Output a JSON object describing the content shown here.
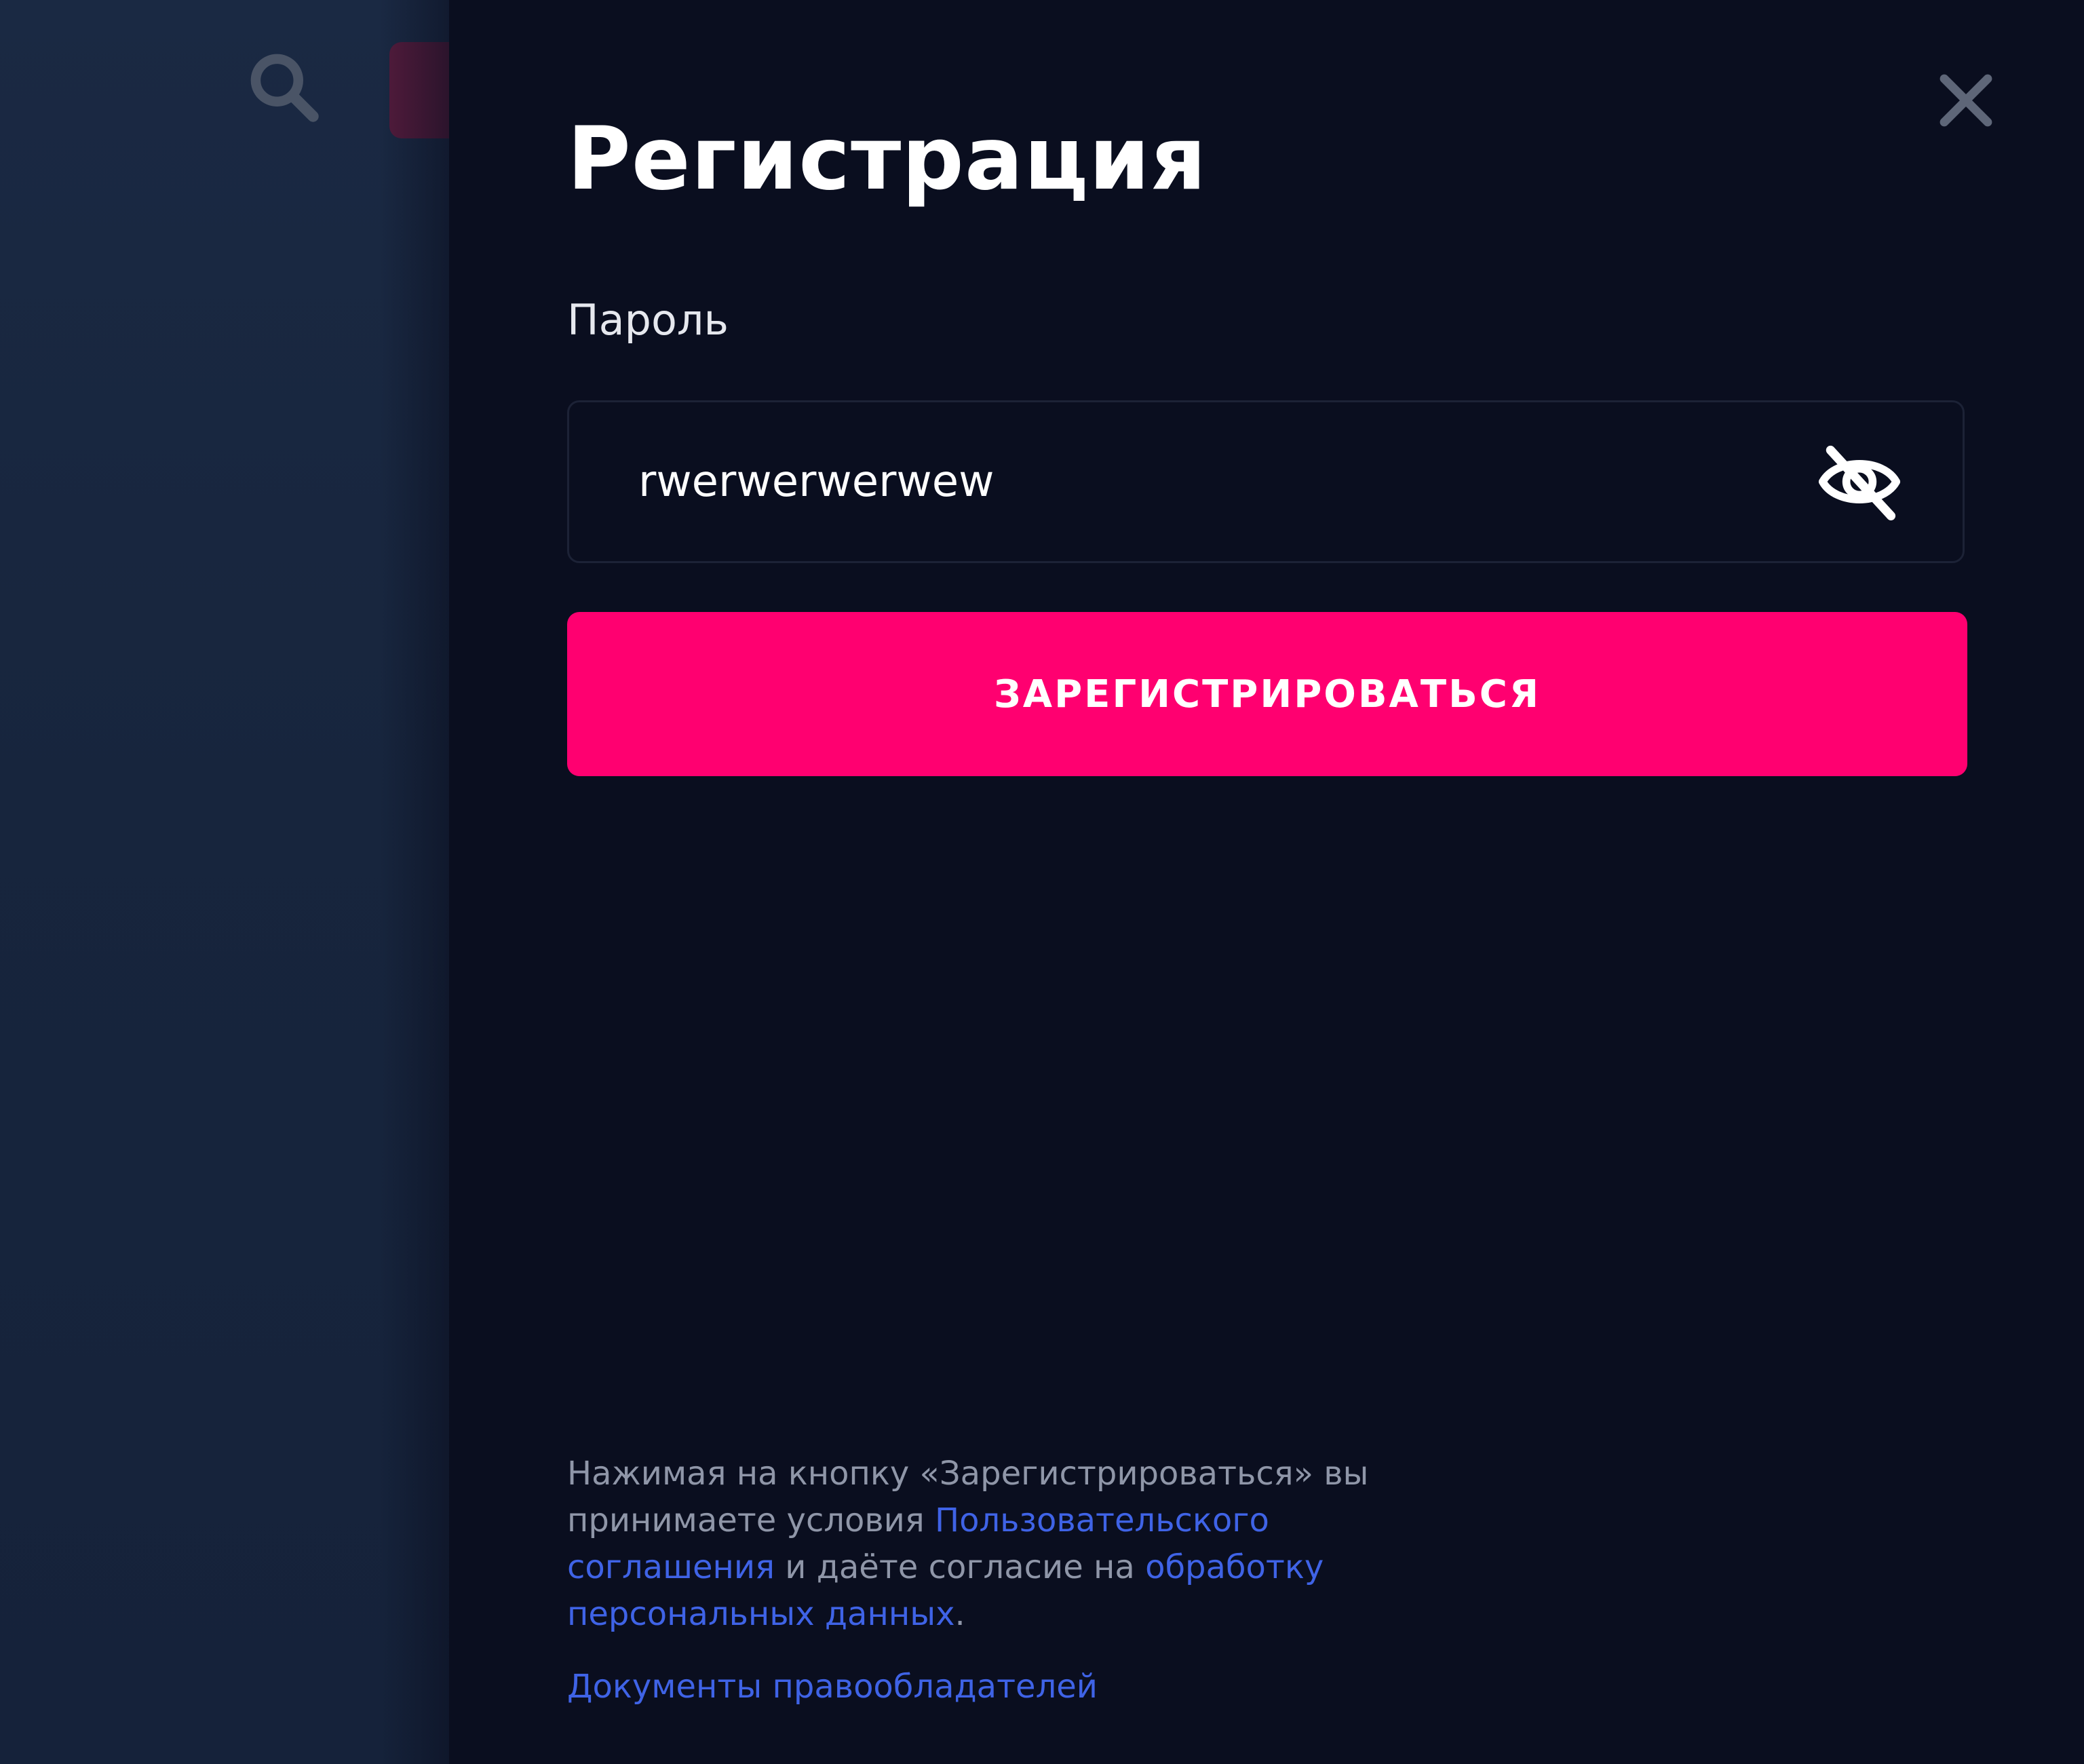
{
  "modal": {
    "title": "Регистрация",
    "password_label": "Пароль",
    "password_value": "rwerwerwerwew",
    "submit_label": "ЗАРЕГИСТРИРОВАТЬСЯ",
    "legal": {
      "text_before": "Нажимая на кнопку «Зарегистрироваться» вы принимаете условия ",
      "link_terms": "Пользовательского соглашения",
      "text_middle": " и даёте согласие на ",
      "link_privacy": "обработку персональных данных",
      "text_after": "."
    },
    "docs_link": "Документы правообладателей"
  },
  "icons": {
    "close": "close-icon",
    "eye_toggle": "eye-off-icon",
    "search": "search-icon"
  },
  "colors": {
    "background": "#0a0e1f",
    "accent": "#ff0070",
    "link": "#3f63e6",
    "muted_text": "#8f96a8"
  }
}
